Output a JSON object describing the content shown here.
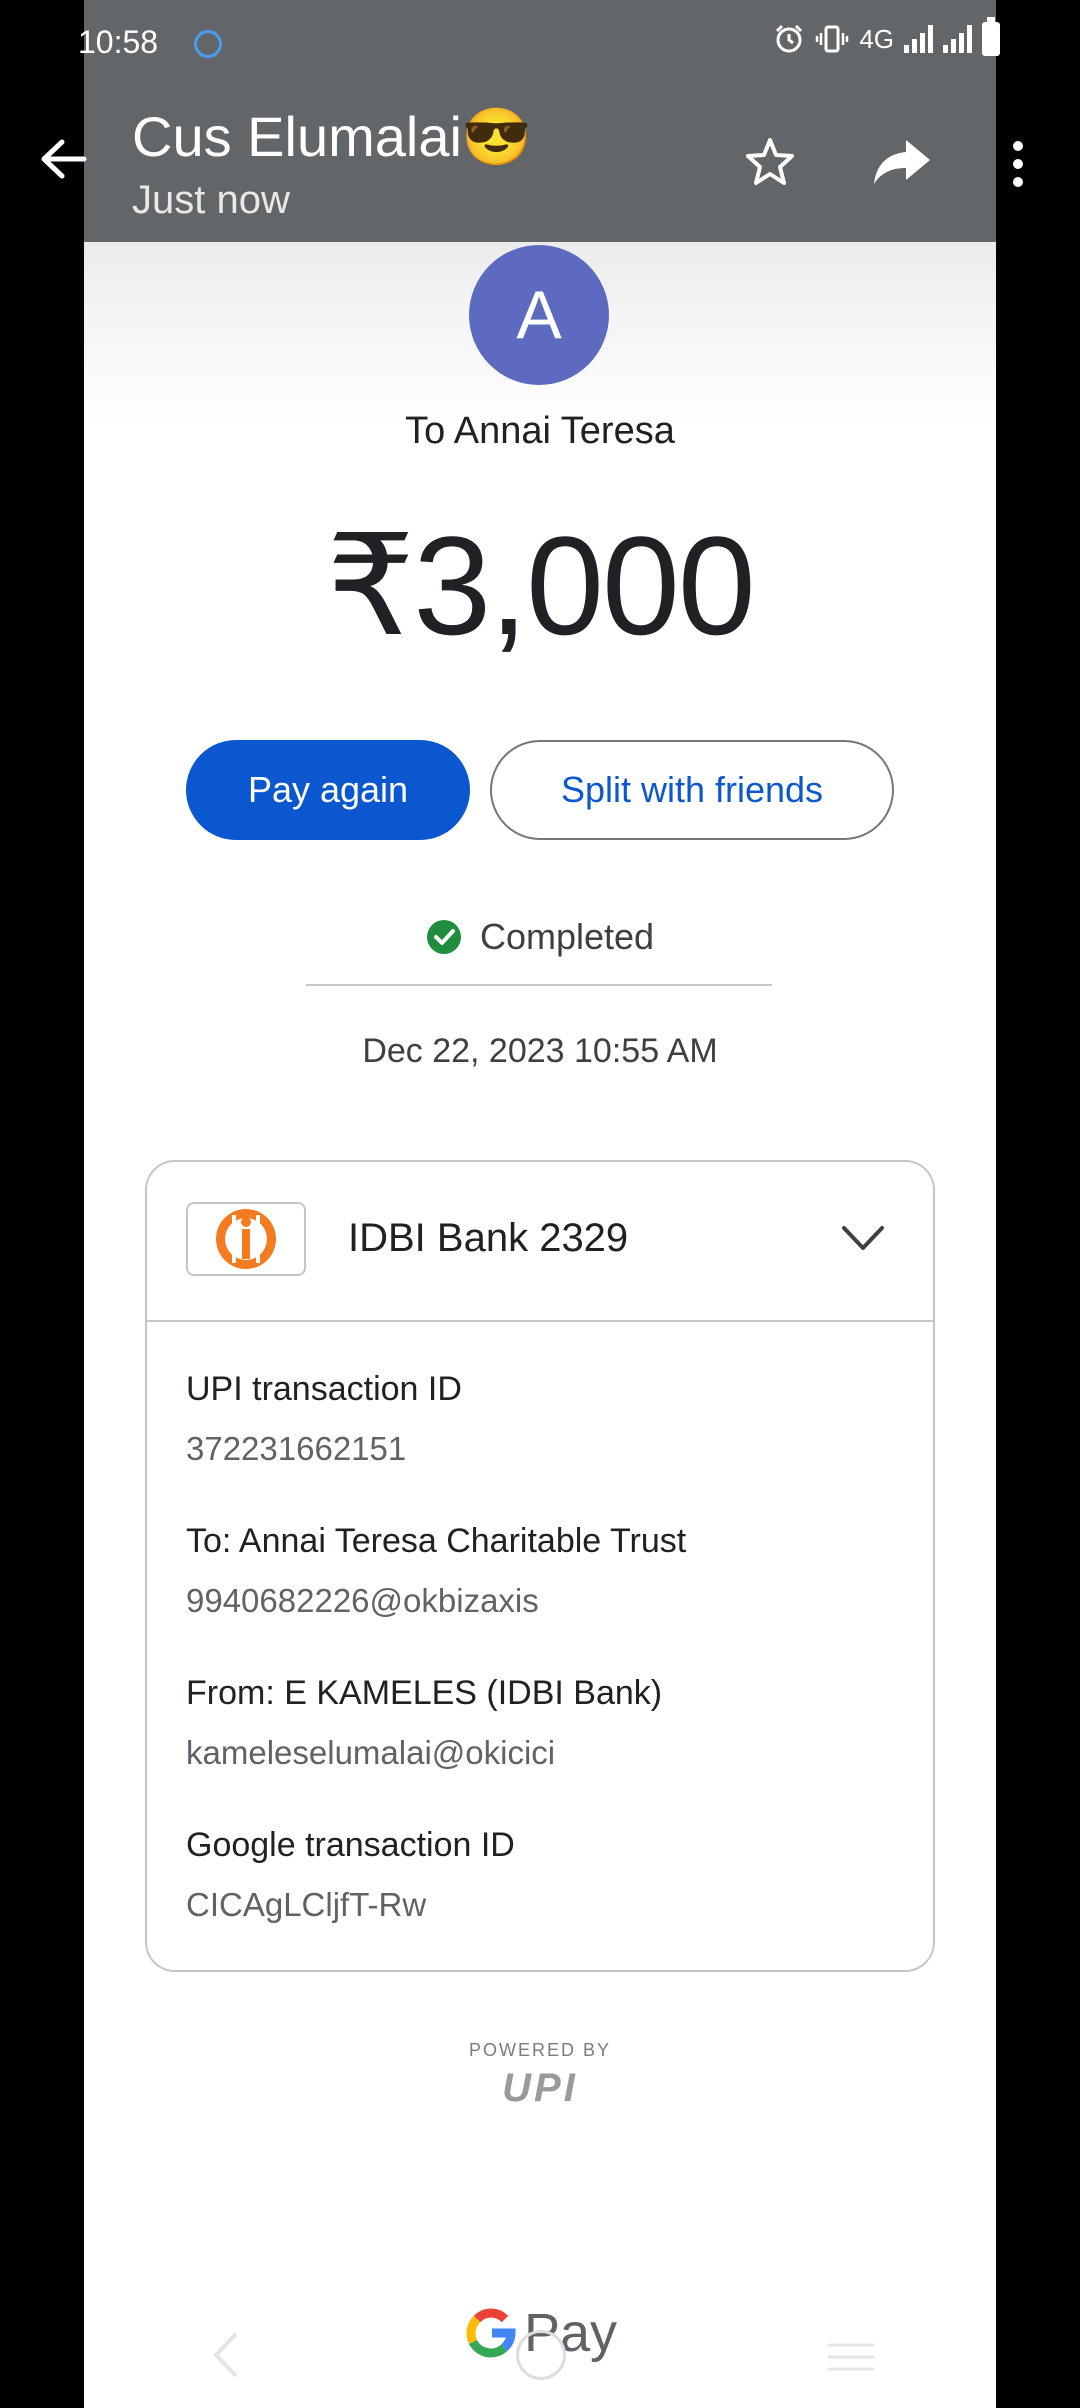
{
  "status_bar": {
    "time": "10:58",
    "network": "4G"
  },
  "chat": {
    "title": "Cus Elumalai😎",
    "subtitle": "Just now"
  },
  "receipt": {
    "avatar_letter": "A",
    "to_label": "To Annai Teresa",
    "amount": "₹3,000",
    "pay_again": "Pay again",
    "split": "Split with friends",
    "status": "Completed",
    "date_time": "Dec 22, 2023 10:55 AM",
    "bank_name": "IDBI Bank 2329",
    "details": [
      {
        "label": "UPI transaction ID",
        "value": "372231662151"
      },
      {
        "label": "To: Annai Teresa Charitable Trust",
        "value": "9940682226@okbizaxis"
      },
      {
        "label": "From: E KAMELES (IDBI Bank)",
        "value": "kameleselumalai@okicici"
      },
      {
        "label": "Google transaction ID",
        "value": "CICAgLCljfT-Rw"
      }
    ],
    "powered_by": "POWERED BY",
    "upi_logo": "UPI",
    "gpay": "Pay"
  },
  "colors": {
    "accent": "#0b57d0",
    "success": "#1e8e3e",
    "avatar": "#5c6bc0",
    "bank_logo": "#f47b20"
  }
}
